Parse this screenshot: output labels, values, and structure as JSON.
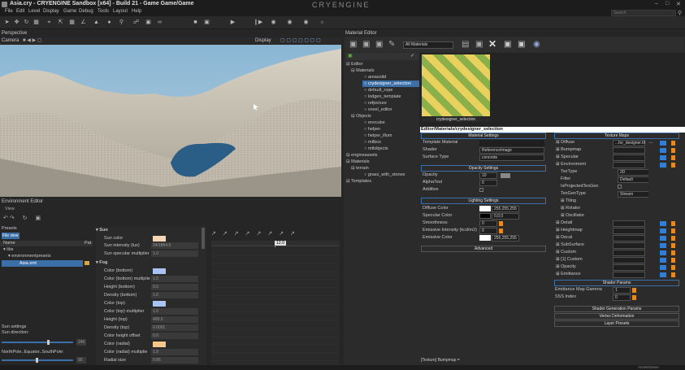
{
  "app": {
    "title": "Asia.cry - CRYENGINE Sandbox  [x64] - Build 21 - Game Game/Game",
    "logo": "CRYENGINE",
    "search_placeholder": "Search"
  },
  "menu": [
    "File",
    "Edit",
    "Level",
    "Display",
    "Game",
    "Debug",
    "Tools",
    "Layout",
    "Help"
  ],
  "perspective": {
    "title": "Perspective",
    "camera": "Camera",
    "display": "Display"
  },
  "env": {
    "title": "Environment Editor",
    "view": "View",
    "presets": "Presets",
    "fileview": "File view",
    "col_name": "Name",
    "col_pat": "Pat",
    "tree": [
      "libs",
      "environmentpresets",
      "Asia.xml"
    ],
    "sun_settings": "Sun settings",
    "sun_direction": "Sun direction:",
    "sun_dir_val": "240",
    "nsp": "NorthPole..Equator..SouthPole:",
    "nsp_val": "90",
    "groups": {
      "sun": "Sun",
      "fog": "Fog"
    },
    "params": [
      {
        "label": "Sun color",
        "value": "",
        "color": "#f5d7b8"
      },
      {
        "label": "Sun intensity (lux)",
        "value": "24/1854.5",
        "color": ""
      },
      {
        "label": "Sun specular multiplier",
        "value": "1.0",
        "color": ""
      },
      {
        "label": "Color (bottom)",
        "value": "",
        "color": "#a9c4f2"
      },
      {
        "label": "Color (bottom) multiplie",
        "value": "1.0",
        "color": ""
      },
      {
        "label": "Height (bottom)",
        "value": "0.0",
        "color": ""
      },
      {
        "label": "Density (bottom)",
        "value": "1.0",
        "color": ""
      },
      {
        "label": "Color (top)",
        "value": "",
        "color": "#a9c4f2"
      },
      {
        "label": "Color (top) multiplier",
        "value": "1.0",
        "color": ""
      },
      {
        "label": "Height (top)",
        "value": "400.0",
        "color": ""
      },
      {
        "label": "Density (top)",
        "value": "0.0001",
        "color": ""
      },
      {
        "label": "Color height offset",
        "value": "0.0",
        "color": ""
      },
      {
        "label": "Color (radial)",
        "value": "",
        "color": "#f5c78a"
      },
      {
        "label": "Color (radial) multiplie",
        "value": "1.0",
        "color": ""
      },
      {
        "label": "Radial size",
        "value": "0.85",
        "color": ""
      }
    ],
    "time_marker": "12.0"
  },
  "mat": {
    "title": "Material Editor",
    "dropdown": "All Materials",
    "tree": [
      "Editor",
      "Materials",
      "areasolid",
      "crydesigner_selection",
      "default_rope",
      "lodgen_template",
      "refpicture",
      "voxel_editor",
      "Objects",
      "envcube",
      "helper",
      "helper_illum",
      "mtlbox",
      "mtlobjects",
      "engineassets",
      "Materials",
      "terrain",
      "grass_with_stones",
      "Templates"
    ],
    "preview_label": "crydesigner_selection",
    "path": "Editor/Materials/crydesigner_selection",
    "mset": "Material Settings",
    "template": "Template Material",
    "shader": "Shader",
    "shader_val": "ReferenceImage",
    "surface": "Surface Type",
    "surface_val": "concrete",
    "oset": "Opacity Settings",
    "opacity": "Opacity",
    "opacity_val": "10",
    "alphatest": "AlphaTest",
    "alphatest_val": "0",
    "additive": "Additive",
    "lset": "Lighting Settings",
    "diffuse": "Diffuse Color",
    "diffuse_val": "255,255,255",
    "specular": "Specular Color",
    "specular_val": "0,0,0",
    "smooth": "Smoothness",
    "smooth_val": "0",
    "emiss": "Emissive Intensity (kcd/m2)",
    "emiss_val": "0",
    "emissc": "Emissive Color",
    "emissc_val": "255,255,255",
    "advanced": "Advanced",
    "texmaps": "Texture Maps",
    "tex": [
      {
        "name": "Diffuse",
        "val": "...for_designer.tif"
      },
      {
        "name": "Bumpmap",
        "val": ""
      },
      {
        "name": "Specular",
        "val": ""
      },
      {
        "name": "Environment",
        "val": ""
      }
    ],
    "texsub": [
      {
        "name": "TexType",
        "val": "2D"
      },
      {
        "name": "Filter",
        "val": "Default"
      },
      {
        "name": "IsProjectedTexGen",
        "val": ""
      },
      {
        "name": "TexGenType",
        "val": "Stream"
      }
    ],
    "texsub2": [
      "Tiling",
      "Rotator",
      "Oscillator"
    ],
    "tex2": [
      "Detail",
      "Heightmap",
      "Decal",
      "SubSurface",
      "Custom",
      "[1] Custom",
      "Opacity",
      "Emittance"
    ],
    "shparams": "Shader Params",
    "emg": "Emittance Map Gamma",
    "emg_val": "1",
    "sss": "SSS Index",
    "sss_val": "0",
    "sgp": "Shader Generation Params",
    "vdef": "Vertex Deformation",
    "lpres": "Layer Presets",
    "status": "[Texture] Bumpmap =",
    "statusbar": "AssetsGame"
  }
}
